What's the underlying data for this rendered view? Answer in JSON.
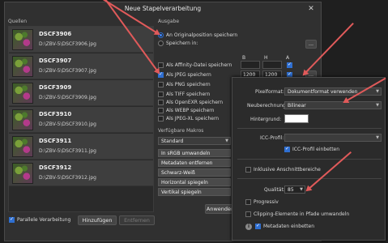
{
  "dialog": {
    "title": "Neue Stapelverarbeitung",
    "close_glyph": "✕"
  },
  "sources": {
    "label": "Quellen",
    "items": [
      {
        "name": "DSCF3906",
        "path": "D:\\ZBV-5\\DSCF3906.jpg"
      },
      {
        "name": "DSCF3907",
        "path": "D:\\ZBV-5\\DSCF3907.jpg"
      },
      {
        "name": "DSCF3909",
        "path": "D:\\ZBV-5\\DSCF3909.jpg"
      },
      {
        "name": "DSCF3910",
        "path": "D:\\ZBV-5\\DSCF3910.jpg"
      },
      {
        "name": "DSCF3911",
        "path": "D:\\ZBV-5\\DSCF3911.jpg"
      },
      {
        "name": "DSCF3912",
        "path": "D:\\ZBV-5\\DSCF3912.jpg"
      }
    ],
    "parallel_label": "Parallele Verarbeitung",
    "add_label": "Hinzufügen",
    "remove_label": "Entfernen"
  },
  "output": {
    "label": "Ausgabe",
    "radio_original": "An Originalposition speichern",
    "radio_save_in": "Speichern in:",
    "browse_label": "...",
    "col_b": "B",
    "col_h": "H",
    "col_a": "A",
    "formats": [
      {
        "label": "Als Affinity-Datei speichern",
        "checked": false
      },
      {
        "label": "Als JPEG speichern",
        "checked": true
      },
      {
        "label": "Als PNG speichern",
        "checked": false
      },
      {
        "label": "Als TIFF speichern",
        "checked": false
      },
      {
        "label": "Als OpenEXR speichern",
        "checked": false
      },
      {
        "label": "Als WEBP speichern",
        "checked": false
      },
      {
        "label": "Als JPEG-XL speichern",
        "checked": false
      }
    ],
    "jpeg_width": "1200",
    "jpeg_height": "1200",
    "jpeg_more": "..."
  },
  "macros": {
    "label": "Verfügbare Makros",
    "category": "Standard",
    "items": [
      "In sRGB umwandeln",
      "Metadaten entfernen",
      "Schwarz-Weiß",
      "Horizontal spiegeln",
      "Vertikal spiegeln"
    ],
    "apply_label": "Anwenden"
  },
  "jpeg_panel": {
    "pixel_format_label": "Pixelformat:",
    "pixel_format_value": "Dokumentformat verwenden",
    "resample_label": "Neuberechnung:",
    "resample_value": "Bilinear",
    "background_label": "Hintergrund:",
    "icc_label": "ICC-Profil:",
    "icc_value": "",
    "icc_embed_label": "ICC-Profil einbetten",
    "bleed_label": "Inklusive Anschnittbereiche",
    "quality_label": "Qualität:",
    "quality_value": "85",
    "progressive_label": "Progressiv",
    "clipping_label": "Clipping-Elemente in Pfade umwandeln",
    "metadata_label": "Metadaten einbetten",
    "info_glyph": "i"
  },
  "colors": {
    "accent": "#2f6fd1",
    "annotation_arrow": "#e05a5a"
  }
}
